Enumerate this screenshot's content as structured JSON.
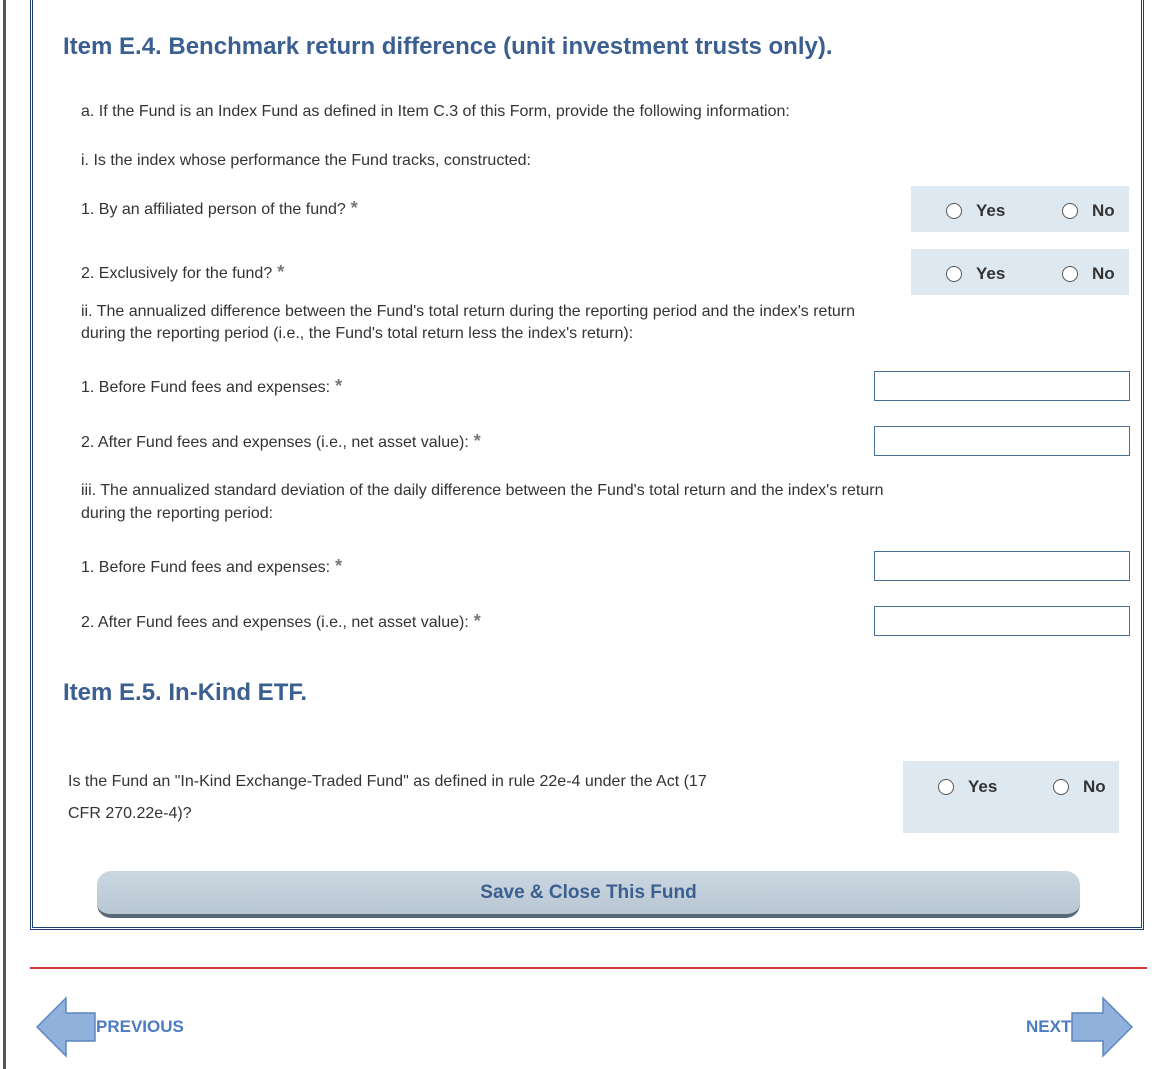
{
  "sections": {
    "e4_title": "Item E.4. Benchmark return difference (unit investment trusts only).",
    "e4_a": "a. If the Fund is an Index Fund as defined in Item C.3 of this Form, provide the following information:",
    "e4_i": "i. Is the index whose performance the Fund tracks, constructed:",
    "e4_i_1": "1. By an affiliated person of the fund?",
    "e4_i_2": "2. Exclusively for the fund?",
    "e4_ii_line1": "ii. The annualized difference between the Fund's total return during the reporting period and the index's return",
    "e4_ii_line2": "during the reporting period (i.e., the Fund's total return less the index's return):",
    "e4_ii_1": "1. Before Fund fees and expenses:",
    "e4_ii_2": "2. After Fund fees and expenses (i.e., net asset value):",
    "e4_iii_line1": "iii. The annualized standard deviation of the daily difference between the Fund's total return and the index's return",
    "e4_iii_line2": "during the reporting period:",
    "e4_iii_1": "1. Before Fund fees and expenses:",
    "e4_iii_2": "2. After Fund fees and expenses (i.e., net asset value):",
    "e5_title": "Item E.5. In-Kind ETF.",
    "e5_q_line1": "Is the Fund an \"In-Kind Exchange-Traded Fund\" as defined in rule 22e-4 under the Act (17",
    "e5_q_line2": "CFR 270.22e-4)?"
  },
  "required_mark": "*",
  "radio": {
    "yes": "Yes",
    "no": "No"
  },
  "inputs": {
    "e4_ii_1": "",
    "e4_ii_2": "",
    "e4_iii_1": "",
    "e4_iii_2": ""
  },
  "buttons": {
    "save": "Save & Close This Fund"
  },
  "nav": {
    "previous": "PREVIOUS",
    "next": "NEXT"
  },
  "colors": {
    "heading": "#3a5f90",
    "radio_bg": "#dde8f1",
    "divider": "#cf3a3a",
    "nav_arrow": "#8fb1dc",
    "border": "#1f3f75"
  }
}
